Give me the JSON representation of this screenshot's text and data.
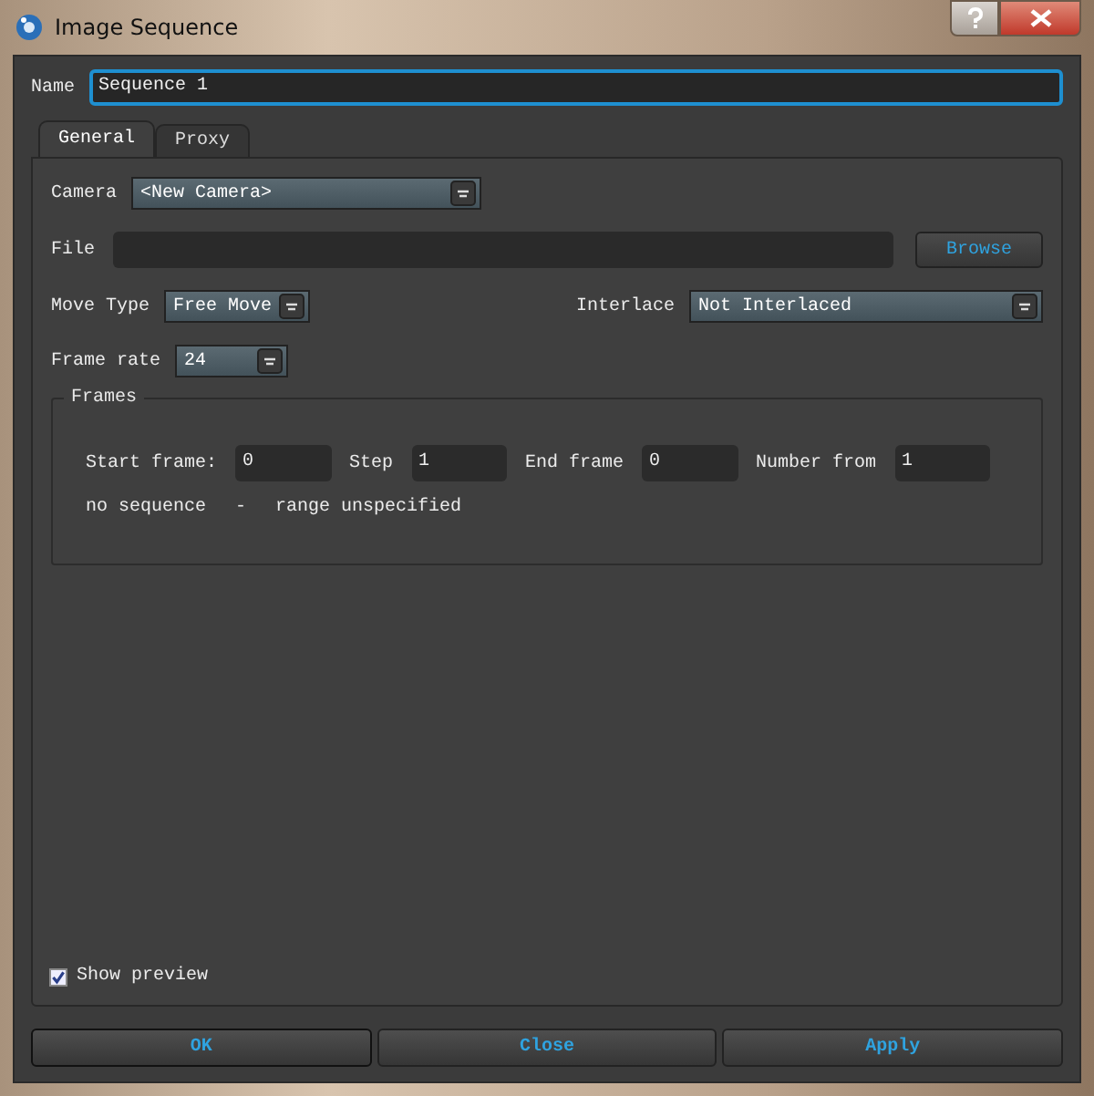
{
  "window": {
    "title": "Image Sequence"
  },
  "name_field": {
    "label": "Name",
    "value": "Sequence 1"
  },
  "tabs": [
    {
      "label": "General",
      "selected": true
    },
    {
      "label": "Proxy",
      "selected": false
    }
  ],
  "camera": {
    "label": "Camera",
    "value": "<New Camera>"
  },
  "file": {
    "label": "File",
    "button": "Browse"
  },
  "move_type": {
    "label": "Move Type",
    "value": "Free Move"
  },
  "interlace": {
    "label": "Interlace",
    "value": "Not Interlaced"
  },
  "frame_rate": {
    "label": "Frame rate",
    "value": "24"
  },
  "frames": {
    "title": "Frames",
    "fields": [
      {
        "label": "Start frame:",
        "value": "0"
      },
      {
        "label": "Step",
        "value": "1"
      },
      {
        "label": "End frame",
        "value": "0"
      },
      {
        "label": "Number from",
        "value": "1"
      }
    ],
    "status": [
      "no sequence",
      "-",
      "range unspecified"
    ]
  },
  "show_preview": {
    "label": "Show preview",
    "checked": true
  },
  "buttons": [
    "OK",
    "Close",
    "Apply"
  ]
}
